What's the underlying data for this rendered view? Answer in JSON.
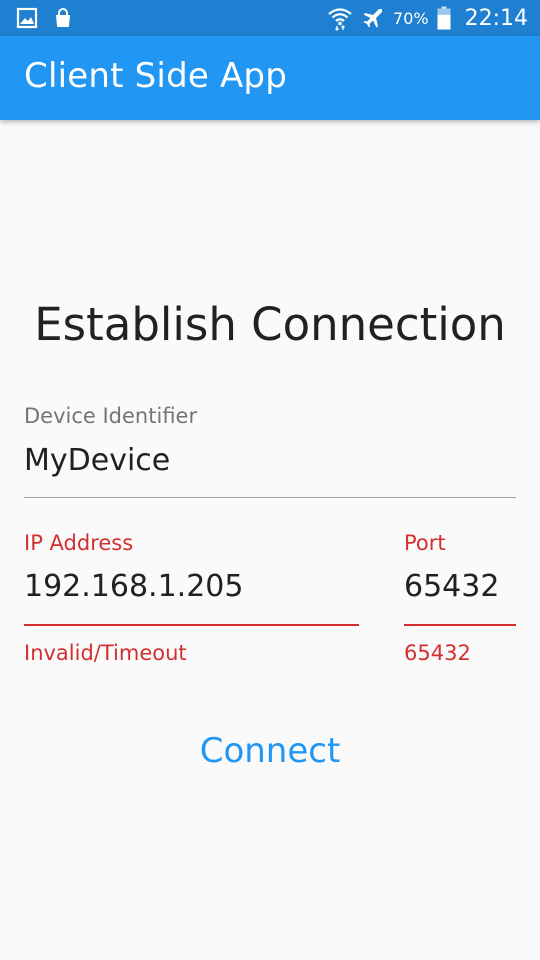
{
  "status_bar": {
    "left_icons": [
      "gallery-icon",
      "shopping-bag-icon"
    ],
    "right_icons": [
      "wifi-icon",
      "airplane-mode-icon",
      "battery-icon"
    ],
    "battery_percent": "70%",
    "battery_level": 0.7,
    "time": "22:14"
  },
  "app_bar": {
    "title": "Client Side App"
  },
  "main": {
    "heading": "Establish Connection",
    "device_identifier": {
      "label": "Device Identifier",
      "value": "MyDevice"
    },
    "ip_address": {
      "label": "IP Address",
      "value": "192.168.1.205",
      "helper": "Invalid/Timeout"
    },
    "port": {
      "label": "Port",
      "value": "65432",
      "helper": "65432"
    },
    "connect_label": "Connect"
  },
  "colors": {
    "status_bar": "#1f7fd0",
    "app_bar": "#2196f3",
    "accent": "#2196f3",
    "error": "#d32f2f",
    "background": "#fafafa"
  }
}
